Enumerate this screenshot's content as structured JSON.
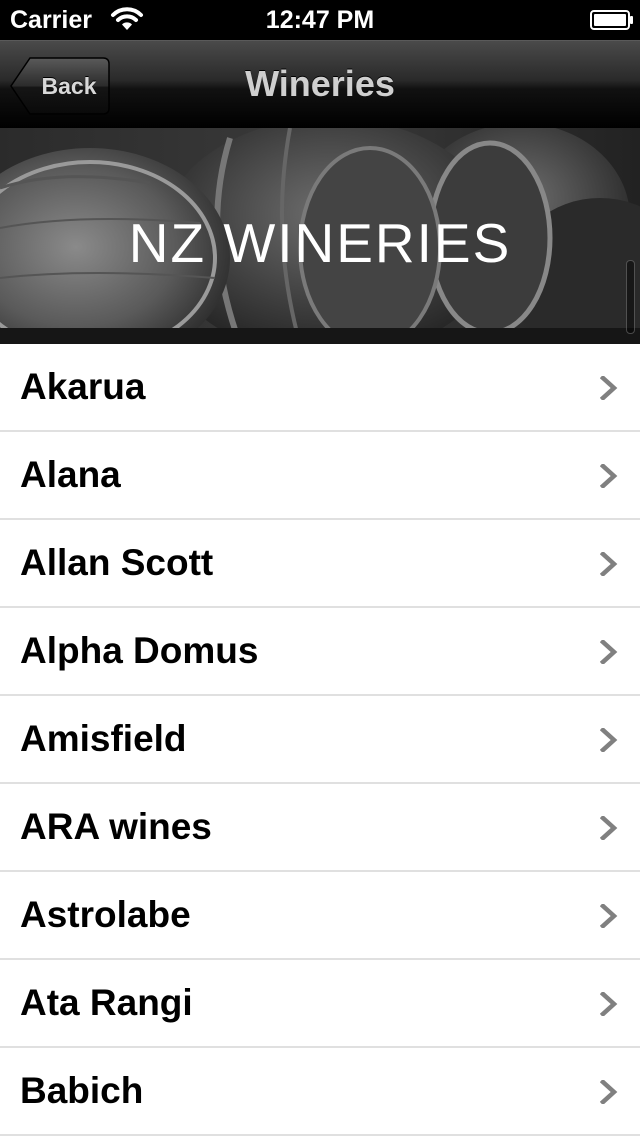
{
  "status_bar": {
    "carrier": "Carrier",
    "time": "12:47 PM",
    "icons": [
      "wifi-icon",
      "battery-icon"
    ]
  },
  "nav_bar": {
    "back_label": "Back",
    "title": "Wineries"
  },
  "banner": {
    "title": "NZ WINERIES"
  },
  "wineries": [
    {
      "name": "Akarua"
    },
    {
      "name": "Alana"
    },
    {
      "name": "Allan Scott"
    },
    {
      "name": "Alpha Domus"
    },
    {
      "name": "Amisfield"
    },
    {
      "name": "ARA wines"
    },
    {
      "name": "Astrolabe"
    },
    {
      "name": "Ata Rangi"
    },
    {
      "name": "Babich"
    }
  ],
  "colors": {
    "nav_gradient_top": "#4a4a4a",
    "nav_gradient_bottom": "#000000",
    "separator": "#e0e0e0",
    "chevron": "#808080"
  }
}
